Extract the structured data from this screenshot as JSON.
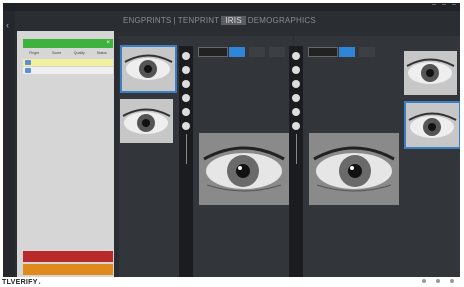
{
  "app": {
    "back_icon": "back-arrow-icon"
  },
  "topnav": {
    "tab1": "ENGPRINTS",
    "tab2": "TENPRINT",
    "tab3": "IRIS",
    "tab4": "DEMOGRAPHICS"
  },
  "left": {
    "capture_label": "",
    "headers": [
      "Finger",
      "Score",
      "Quality",
      "Status"
    ],
    "rows": [
      [
        "",
        "",
        "",
        ""
      ],
      [
        "",
        "",
        "",
        ""
      ]
    ],
    "red_button": "",
    "orange_button": ""
  },
  "mid": {
    "header": "",
    "dropdown": ""
  },
  "right": {
    "header": "",
    "link": ""
  },
  "footer": {
    "brand": "TLVERIFY"
  },
  "colors": {
    "accent_blue": "#2f86d8",
    "green": "#3db33d",
    "red": "#b82a2a",
    "orange": "#e08a1e",
    "dark_bg": "#2a2d32"
  }
}
